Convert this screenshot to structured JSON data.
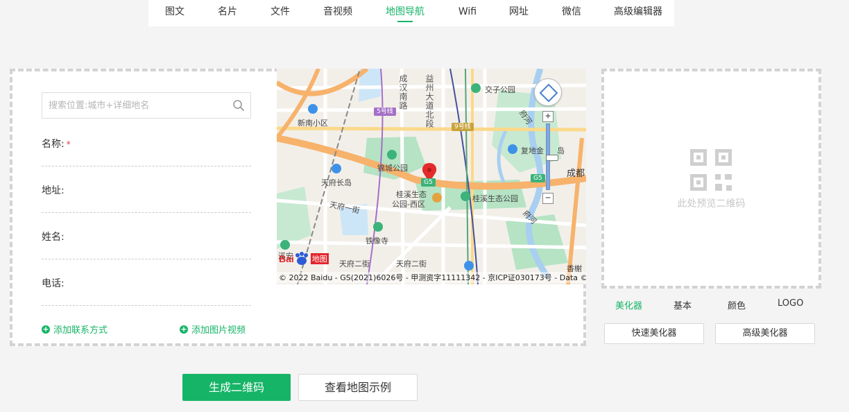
{
  "nav": {
    "tabs": [
      {
        "label": "图文"
      },
      {
        "label": "名片"
      },
      {
        "label": "文件"
      },
      {
        "label": "音视频"
      },
      {
        "label": "地图导航"
      },
      {
        "label": "Wifi"
      },
      {
        "label": "网址"
      },
      {
        "label": "微信"
      },
      {
        "label": "高级编辑器"
      }
    ],
    "active": "地图导航"
  },
  "form": {
    "search": {
      "placeholder": "搜索位置:城市+详细地名",
      "value": ""
    },
    "fields": {
      "name": {
        "label": "名称:",
        "required_mark": "*",
        "value": ""
      },
      "address": {
        "label": "地址:",
        "value": ""
      },
      "contact": {
        "label": "姓名:",
        "value": ""
      },
      "phone": {
        "label": "电话:",
        "value": ""
      }
    },
    "add_contact": "添加联系方式",
    "add_media": "添加图片视频"
  },
  "map": {
    "labels": {
      "xinnan": "新南小区",
      "jincheng": "锦城公园",
      "tianfu": "天府长岛",
      "guixi_west_1": "桂溪生态",
      "guixi_west_2": "公园-西区",
      "guixi": "桂溪生态公园",
      "tianfu_1st": "天府一街",
      "tiexiang": "铁像寺",
      "tianfu_2nd_a": "天府二街",
      "tianfu_2nd_b": "天府二街",
      "jiaozi": "交子公园",
      "fudi": "复地金",
      "fudi_suffix": "岛",
      "chengdu": "成都",
      "xi": "溪安",
      "xiangshu": "香榭",
      "chenghan": "成汉南路",
      "yizhou": "益州大道北段",
      "fuhe": "府河",
      "fuhe2": "府河"
    },
    "badges": {
      "line9": "9号线",
      "line5": "5号线",
      "g5a": "G5",
      "g5b": "G5"
    },
    "logo_text": "Bai",
    "logo_suffix": "地图",
    "copyright": "© 2022 Baidu - GS(2021)6026号 - 甲测资字11111342 - 京ICP证030173号 - Data ©",
    "zoom_in": "+",
    "zoom_out": "−",
    "zoom_level_fraction": 0.5
  },
  "preview": {
    "hint": "此处预览二维码"
  },
  "beautify": {
    "tabs": [
      {
        "label": "美化器"
      },
      {
        "label": "基本"
      },
      {
        "label": "颜色"
      },
      {
        "label": "LOGO"
      }
    ],
    "active": "美化器",
    "quick": "快速美化器",
    "advanced": "高级美化器"
  },
  "actions": {
    "generate": "生成二维码",
    "example": "查看地图示例"
  },
  "colors": {
    "accent": "#16b467",
    "required": "#e4393c"
  }
}
